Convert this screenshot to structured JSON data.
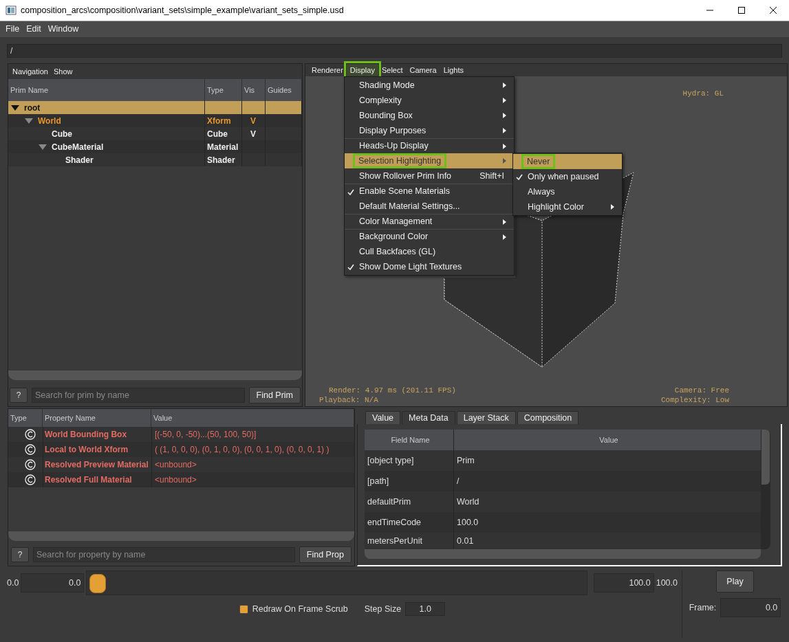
{
  "window": {
    "title": "composition_arcs\\composition\\variant_sets\\simple_example\\variant_sets_simple.usd"
  },
  "menubar": [
    "File",
    "Edit",
    "Window"
  ],
  "path_field": {
    "value": "/"
  },
  "prim_browser": {
    "menus": [
      "Navigation",
      "Show"
    ],
    "columns": [
      "Prim Name",
      "Type",
      "Vis",
      "Guides"
    ],
    "rows": [
      {
        "name": "root",
        "selected": true,
        "expanded": true,
        "highlighted": false,
        "children": [
          {
            "name": "World",
            "type": "Xform",
            "vis": "V",
            "selected": false,
            "expanded": true,
            "highlighted": true,
            "children": [
              {
                "name": "Cube",
                "type": "Cube",
                "vis": "V",
                "selected": false,
                "highlighted": false
              },
              {
                "name": "CubeMaterial",
                "type": "Material",
                "selected": false,
                "expanded": true,
                "highlighted": false,
                "children": [
                  {
                    "name": "Shader",
                    "type": "Shader",
                    "selected": false,
                    "highlighted": false
                  }
                ]
              }
            ]
          }
        ]
      }
    ],
    "help": "?",
    "search": {
      "placeholder": "Search for prim by name"
    },
    "find_button": "Find Prim"
  },
  "viewport": {
    "menus": [
      {
        "label": "Renderer",
        "selected": false,
        "annotated": false
      },
      {
        "label": "Display",
        "selected": true,
        "annotated": true
      },
      {
        "label": "Select",
        "selected": false,
        "annotated": false
      },
      {
        "label": "Camera",
        "selected": false,
        "annotated": false
      },
      {
        "label": "Lights",
        "selected": false,
        "annotated": false
      }
    ],
    "hud": {
      "renderer": "Hydra: GL",
      "render": "Render: 4.97 ms (201.11 FPS)",
      "playback": "Playback: N/A",
      "camera": "Camera: Free",
      "complexity": "Complexity: Low"
    }
  },
  "display_menu": [
    {
      "label": "Shading Mode",
      "kind": "submenu",
      "checked": false,
      "selected": false,
      "annotated": false,
      "separator_before": false
    },
    {
      "label": "Complexity",
      "kind": "submenu",
      "checked": false,
      "selected": false,
      "annotated": false,
      "separator_before": false
    },
    {
      "label": "Bounding Box",
      "kind": "submenu",
      "checked": false,
      "selected": false,
      "annotated": false,
      "separator_before": false
    },
    {
      "label": "Display Purposes",
      "kind": "submenu",
      "checked": false,
      "selected": false,
      "annotated": false,
      "separator_before": false
    },
    {
      "label": "Heads-Up Display",
      "kind": "submenu",
      "checked": false,
      "selected": false,
      "annotated": false,
      "separator_before": true
    },
    {
      "label": "Selection Highlighting",
      "kind": "submenu",
      "checked": false,
      "selected": true,
      "annotated": true,
      "separator_before": false
    },
    {
      "label": "Show Rollover Prim Info",
      "kind": "action",
      "shortcut": "Shift+I",
      "checked": false,
      "selected": false,
      "annotated": false,
      "separator_before": false
    },
    {
      "label": "Enable Scene Materials",
      "kind": "action",
      "checked": true,
      "selected": false,
      "annotated": false,
      "separator_before": true
    },
    {
      "label": "Default Material Settings...",
      "kind": "action",
      "checked": false,
      "selected": false,
      "annotated": false,
      "separator_before": false
    },
    {
      "label": "Color Management",
      "kind": "submenu",
      "checked": false,
      "selected": false,
      "annotated": false,
      "separator_before": true
    },
    {
      "label": "Background Color",
      "kind": "submenu",
      "checked": false,
      "selected": false,
      "annotated": false,
      "separator_before": true
    },
    {
      "label": "Cull Backfaces (GL)",
      "kind": "action",
      "checked": false,
      "selected": false,
      "annotated": false,
      "separator_before": false
    },
    {
      "label": "Show Dome Light Textures",
      "kind": "action",
      "checked": true,
      "selected": false,
      "annotated": false,
      "separator_before": false
    }
  ],
  "highlight_submenu": [
    {
      "label": "Never",
      "kind": "action",
      "checked": false,
      "selected": true,
      "annotated": true
    },
    {
      "label": "Only when paused",
      "kind": "action",
      "checked": true,
      "selected": false,
      "annotated": false
    },
    {
      "label": "Always",
      "kind": "action",
      "checked": false,
      "selected": false,
      "annotated": false
    },
    {
      "label": "Highlight Color",
      "kind": "submenu",
      "checked": false,
      "selected": false,
      "annotated": false
    }
  ],
  "properties": {
    "columns": [
      "Type",
      "Property Name",
      "Value"
    ],
    "rows": [
      {
        "name": "World Bounding Box",
        "value": "[(-50, 0, -50)...(50, 100, 50)]"
      },
      {
        "name": "Local to World Xform",
        "value": "( (1, 0, 0, 0), (0, 1, 0, 0), (0, 0, 1, 0), (0, 0, 0, 1) )"
      },
      {
        "name": "Resolved Preview Material",
        "value": "<unbound>"
      },
      {
        "name": "Resolved Full Material",
        "value": "<unbound>"
      }
    ],
    "help": "?",
    "search": {
      "placeholder": "Search for property by name"
    },
    "find_button": "Find Prop"
  },
  "inspector": {
    "tabs": [
      {
        "label": "Value",
        "selected": false
      },
      {
        "label": "Meta Data",
        "selected": true
      },
      {
        "label": "Layer Stack",
        "selected": false
      },
      {
        "label": "Composition",
        "selected": false
      }
    ],
    "columns": [
      "Field Name",
      "Value"
    ],
    "rows": [
      {
        "field": "[object type]",
        "value": "Prim"
      },
      {
        "field": "[path]",
        "value": "/"
      },
      {
        "field": "defaultPrim",
        "value": "World"
      },
      {
        "field": "endTimeCode",
        "value": "100.0"
      },
      {
        "field": "metersPerUnit",
        "value": "0.01"
      }
    ]
  },
  "timeline": {
    "start_label": "0.0",
    "start_value": "0.0",
    "level": 0,
    "end_value": "100.0",
    "end_label": "100.0",
    "play_button": "Play",
    "frame_label": "Frame:",
    "frame_value": "0.0",
    "redraw": {
      "label": "Redraw On Frame Scrub",
      "checked": true
    },
    "step_label": "Step Size",
    "step_value": "1.0"
  }
}
